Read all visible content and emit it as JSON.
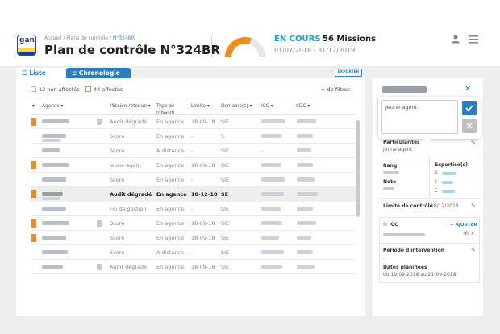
{
  "header": {
    "logo_text": "gan",
    "breadcrumb": {
      "home": "Accueil",
      "sep": " / ",
      "plans": "Plans de contrôle",
      "current": "N°324BR"
    },
    "title": "Plan de contrôle N°324BR",
    "status": "EN COURS",
    "missions": "56 Missions",
    "period": "01/07/2018 - 31/12/2019",
    "gauge_fraction": 0.6,
    "colors": {
      "accent": "#2a7ec4",
      "orange": "#f08c1b",
      "status": "#1f9ed6"
    }
  },
  "tabs": {
    "liste": "Liste",
    "chronologie": "Chronologie"
  },
  "export_label": "EXPORTER",
  "filters": {
    "non_affectes": "12 non affectés",
    "affectes": "44 affectés",
    "more": "+ de filtres"
  },
  "table": {
    "headers": {
      "agence": "Agence",
      "mission": "Mission retenue",
      "type1": "Type de",
      "type2": "mission",
      "limite": "Limite",
      "domaine": "Domaine(s)",
      "icc": "ICC",
      "cdc": "CDC"
    },
    "rows": [
      {
        "mission": "Audit dégradé",
        "type": "En agence",
        "limite": "18-09-18",
        "domaine": "SIE",
        "orange": true,
        "sq": true,
        "hl": false
      },
      {
        "mission": "Score",
        "type": "En agence",
        "limite": "-",
        "domaine": "S",
        "orange": false,
        "sq": false,
        "hl": false
      },
      {
        "mission": "Score",
        "type": "A distance",
        "limite": "-",
        "domaine": "SIE",
        "orange": false,
        "sq": false,
        "hl": false
      },
      {
        "mission": "Jeune agent",
        "type": "En agence",
        "limite": "18-09-18",
        "domaine": "SIE",
        "orange": true,
        "sq": false,
        "hl": false
      },
      {
        "mission": "Score",
        "type": "En agence",
        "limite": "-",
        "domaine": "SIE",
        "orange": false,
        "sq": false,
        "hl": false
      },
      {
        "mission": "Audit dégradé",
        "type": "En agence",
        "limite": "18-12-18",
        "domaine": "SE",
        "orange": true,
        "sq": false,
        "hl": true
      },
      {
        "mission": "Fin de gestion",
        "type": "En agence",
        "limite": "-",
        "domaine": "SIE",
        "orange": false,
        "sq": false,
        "hl": false
      },
      {
        "mission": "Score",
        "type": "En agence",
        "limite": "18-09-18",
        "domaine": "SIE",
        "orange": true,
        "sq": true,
        "hl": false
      },
      {
        "mission": "Score",
        "type": "En agence",
        "limite": "18-09-18",
        "domaine": "SIE",
        "orange": true,
        "sq": false,
        "hl": false
      },
      {
        "mission": "Score",
        "type": "A distance",
        "limite": "-",
        "domaine": "SIE",
        "orange": false,
        "sq": false,
        "hl": false
      },
      {
        "mission": "Audit dégradé",
        "type": "En agence",
        "limite": "18-09-18",
        "domaine": "SIE",
        "orange": false,
        "sq": true,
        "hl": false
      }
    ]
  },
  "side": {
    "popup_value": "Jeune agent",
    "particularites_label": "Particularités",
    "particularites_value": "Jeune agent",
    "rang_label": "Rang",
    "note_label": "Note",
    "expertise_label": "Expertise(s)",
    "expertise_s": "S",
    "expertise_i": "I",
    "expertise_e": "E",
    "limite_label": "Limite de contrôle",
    "limite_value": "18/12/2018",
    "icc_label": "ICC",
    "add_label": "+ AJOUTER",
    "periode_label": "Période d'intervention",
    "periode_value": "-",
    "dates_label": "Dates planifiées",
    "dates_value": "du 19-09-2018 au 21-09-2018"
  }
}
